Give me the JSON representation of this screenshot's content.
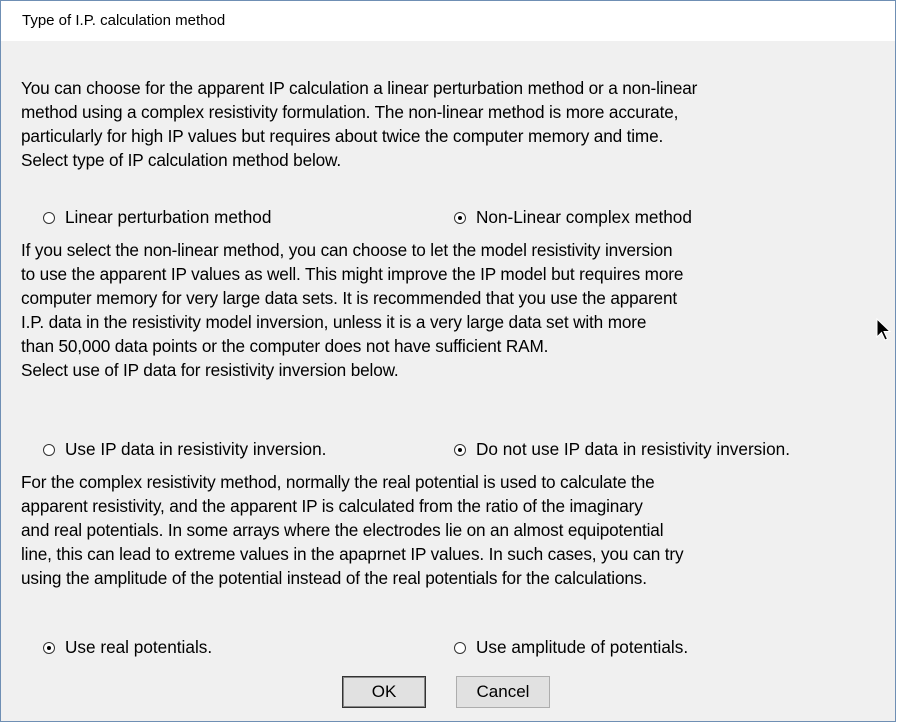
{
  "dialog": {
    "title": "Type of I.P. calculation method"
  },
  "section1": {
    "lines": [
      "You can choose for the apparent IP calculation a linear perturbation method or a non-linear",
      "method using a complex resistivity formulation. The non-linear method is more accurate,",
      "particularly for high IP values but requires about twice the computer memory and time.",
      "Select type of IP calculation method below."
    ],
    "options": [
      {
        "label": "Linear perturbation method",
        "checked": false
      },
      {
        "label": "Non-Linear complex method",
        "checked": true
      }
    ]
  },
  "section2": {
    "lines": [
      "If you select the non-linear method, you can choose to let the model resistivity inversion",
      "to use the apparent IP values as well. This might improve the IP model but requires more",
      "computer memory for very large data sets. It is recommended that you use the apparent",
      "I.P. data in the resistivity model inversion, unless it is a very large data set with more",
      "than 50,000 data points or the computer does not have sufficient RAM.",
      "Select use of IP data for resistivity inversion below."
    ],
    "options": [
      {
        "label": "Use IP data in resistivity inversion.",
        "checked": false
      },
      {
        "label": "Do not use IP data in resistivity inversion.",
        "checked": true
      }
    ]
  },
  "section3": {
    "lines": [
      "For the complex resistivity method, normally the real potential is used to calculate the",
      "apparent resistivity, and the apparent IP is calculated from the ratio of the imaginary",
      "and real potentials. In some arrays where the electrodes lie on an almost equipotential",
      "line, this can lead to extreme values in the apaprnet IP values. In such cases, you can try",
      "using the amplitude of the potential instead of the real potentials for the calculations."
    ],
    "options": [
      {
        "label": "Use real potentials.",
        "checked": true
      },
      {
        "label": "Use amplitude of potentials.",
        "checked": false
      }
    ]
  },
  "buttons": {
    "ok": "OK",
    "cancel": "Cancel"
  },
  "icons": {
    "cursor": "mouse-pointer-icon"
  }
}
